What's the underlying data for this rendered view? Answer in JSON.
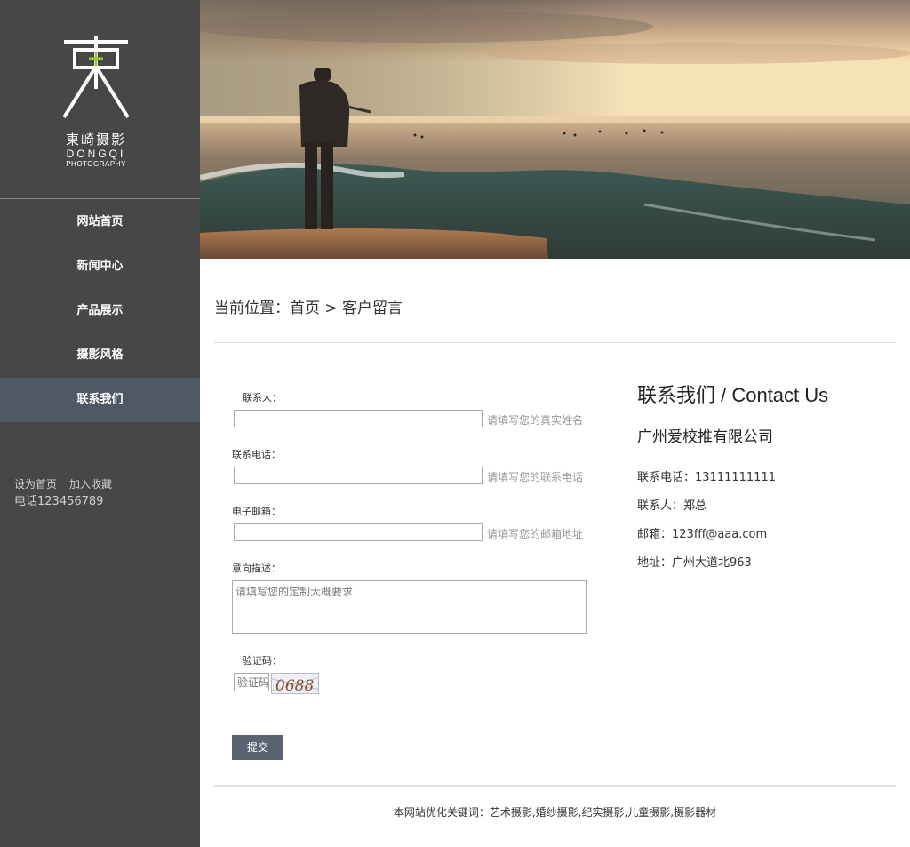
{
  "sidebar": {
    "logo": {
      "name_cn": "東崎摄影",
      "name_en": "DONGQI",
      "name_en_sub": "PHOTOGRAPHY"
    },
    "nav": [
      {
        "label": "网站首页"
      },
      {
        "label": "新闻中心"
      },
      {
        "label": "产品展示"
      },
      {
        "label": "摄影风格"
      },
      {
        "label": "联系我们",
        "active": true
      }
    ],
    "links": {
      "set_home": "设为首页",
      "bookmark": "加入收藏"
    },
    "phone": "电话123456789"
  },
  "breadcrumb": {
    "text": "当前位置：首页 > 客户留言"
  },
  "form": {
    "name_label": "联系人：",
    "name_hint": "请填写您的真实姓名",
    "phone_label": "联系电话：",
    "phone_hint": "请填写您的联系电话",
    "email_label": "电子邮箱：",
    "email_hint": "请填写您的邮箱地址",
    "desc_label": "意向描述：",
    "desc_placeholder": "请填写您的定制大概要求",
    "captcha_label": "验证码：",
    "captcha_placeholder": "验证码",
    "captcha_code": "0688",
    "submit_label": "提交"
  },
  "contact": {
    "title": "联系我们 / Contact Us",
    "company": "广州爱校推有限公司",
    "phone": "联系电话：13111111111",
    "person": "联系人：郑总",
    "email": "邮箱：123fff@aaa.com",
    "address": "地址：广州大道北963"
  },
  "footer": {
    "text": "本网站优化关键词：艺术摄影,婚纱摄影,纪实摄影,儿童摄影,摄影器材"
  },
  "colors": {
    "sidebar_bg": "#474747",
    "nav_active_bg": "#4f5865",
    "button_bg": "#5a6371"
  }
}
